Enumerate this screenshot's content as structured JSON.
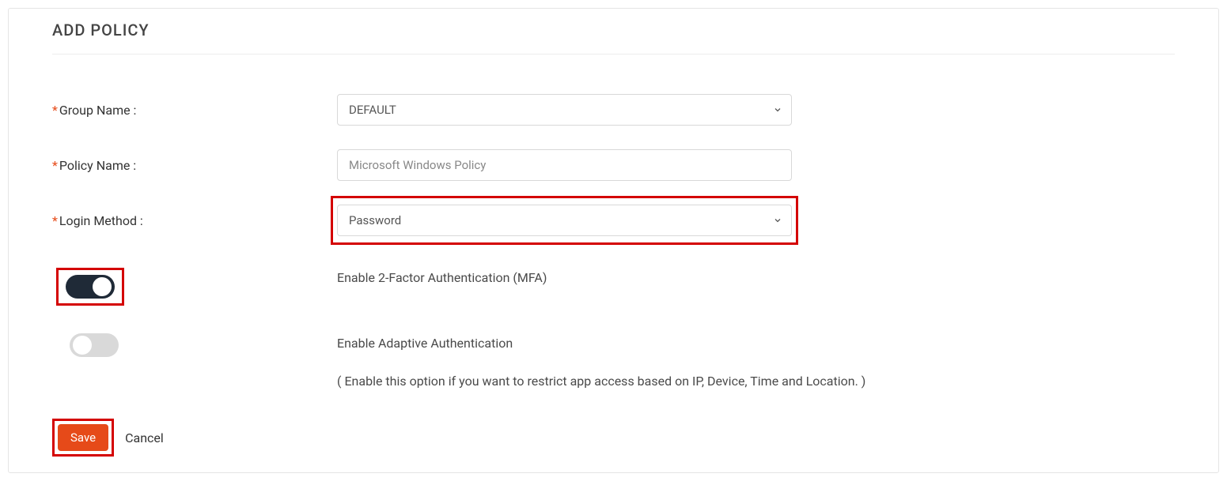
{
  "title": "ADD POLICY",
  "fields": {
    "group_name": {
      "label": "Group Name :",
      "value": "DEFAULT"
    },
    "policy_name": {
      "label": "Policy Name :",
      "value": "Microsoft Windows Policy"
    },
    "login_method": {
      "label": "Login Method :",
      "value": "Password"
    }
  },
  "toggles": {
    "mfa": {
      "label": "Enable 2-Factor Authentication (MFA)",
      "on": true
    },
    "adaptive": {
      "label": "Enable Adaptive Authentication",
      "helper": "( Enable this option if you want to restrict app access based on IP, Device, Time and Location. )",
      "on": false
    }
  },
  "actions": {
    "save": "Save",
    "cancel": "Cancel"
  }
}
